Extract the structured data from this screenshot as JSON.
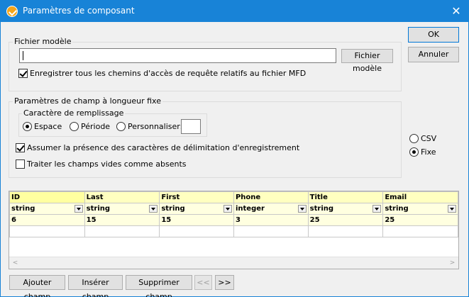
{
  "window": {
    "title": "Paramètres de composant"
  },
  "buttons": {
    "ok": "OK",
    "cancel": "Annuler"
  },
  "template_file": {
    "group_label": "Fichier modèle",
    "path_value": "",
    "browse_label": "Fichier modèle",
    "relative_paths_label": "Enregistrer tous les chemins d'accès de requête relatifs au fichier MFD",
    "relative_paths_checked": true
  },
  "fixed_length": {
    "group_label": "Paramètres de champ à longueur fixe",
    "fill_char": {
      "group_label": "Caractère de remplissage",
      "options": [
        "Espace",
        "Période",
        "Personnaliser:"
      ],
      "selected": "Espace",
      "custom_value": ""
    },
    "record_delimiters_label": "Assumer la présence des caractères de délimitation d'enregistrement",
    "record_delimiters_checked": true,
    "empty_fields_label": "Traiter les champs vides comme absents",
    "empty_fields_checked": false
  },
  "format": {
    "options": [
      "CSV",
      "Fixe"
    ],
    "selected": "Fixe"
  },
  "grid": {
    "columns": [
      {
        "name": "ID",
        "type": "string",
        "length": "6"
      },
      {
        "name": "Last",
        "type": "string",
        "length": "15"
      },
      {
        "name": "First",
        "type": "string",
        "length": "15"
      },
      {
        "name": "Phone",
        "type": "integer",
        "length": "3"
      },
      {
        "name": "Title",
        "type": "string",
        "length": "25"
      },
      {
        "name": "Email",
        "type": "string",
        "length": "25"
      }
    ],
    "scroll_left": "<",
    "scroll_right": ">"
  },
  "field_buttons": {
    "add": "Ajouter champ",
    "insert": "Insérer champ",
    "delete": "Supprimer champ",
    "move_left": "<<",
    "move_right": ">>"
  }
}
